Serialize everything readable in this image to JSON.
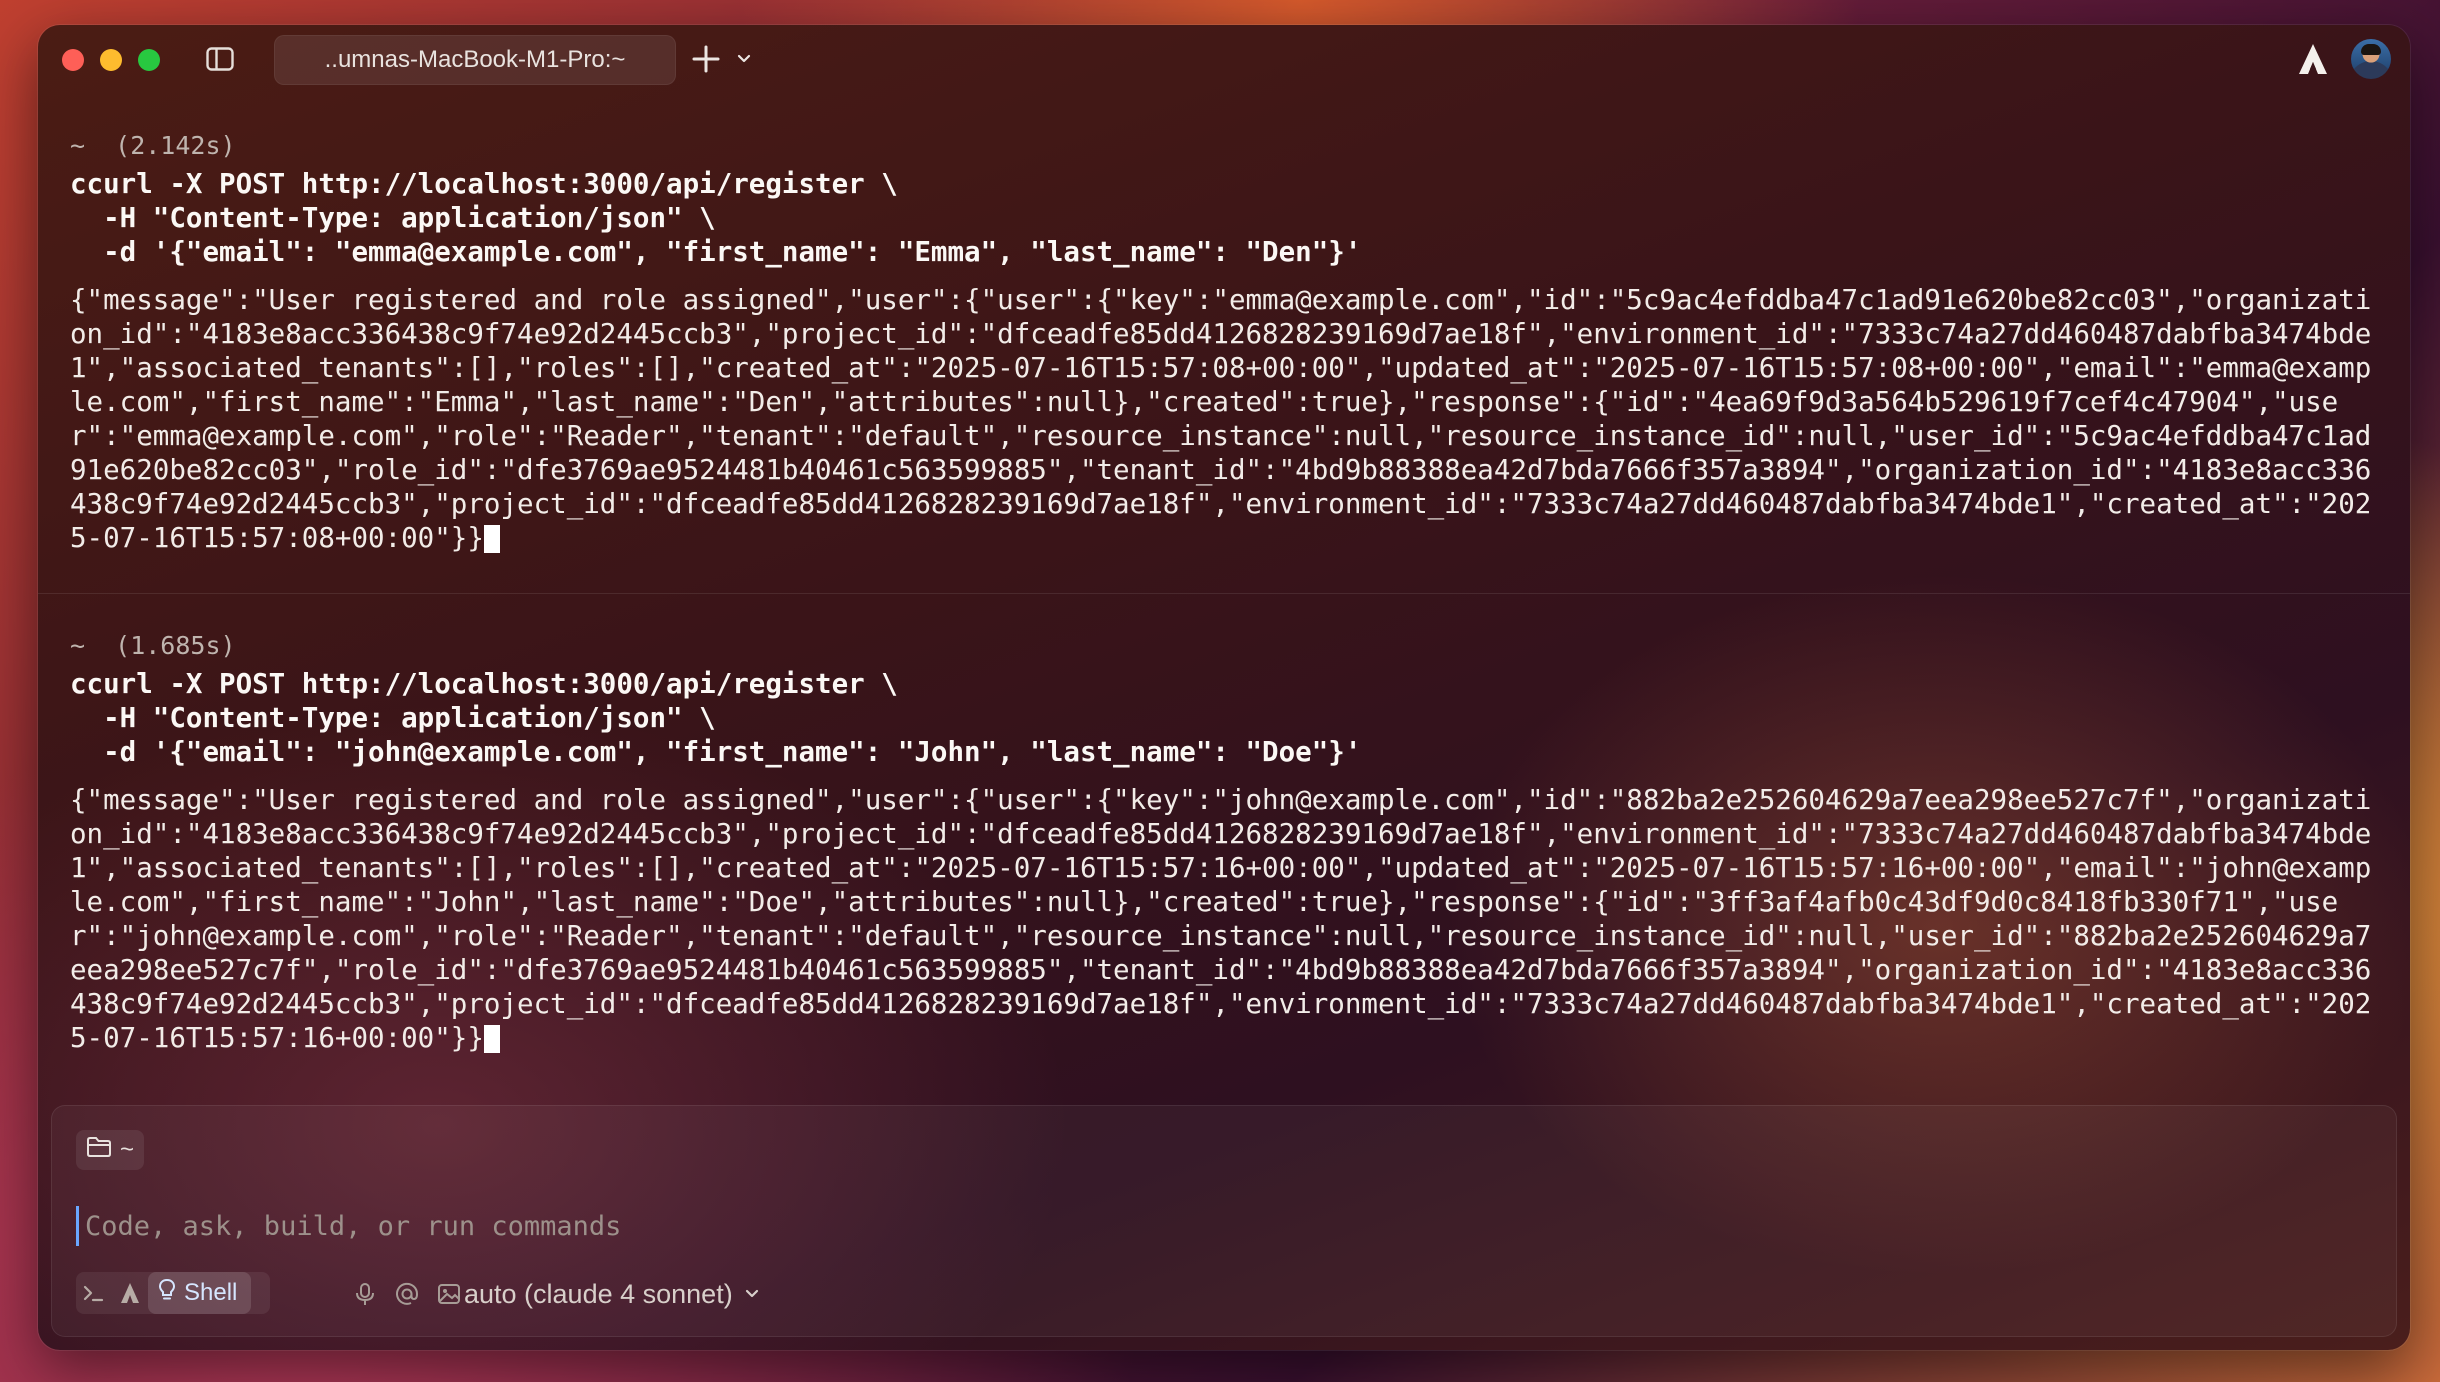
{
  "window": {
    "tab_title": "..umnas-MacBook-M1-Pro:~"
  },
  "blocks": [
    {
      "meta": "~  (2.142s)",
      "command_lines": [
        "ccurl -X POST http://localhost:3000/api/register \\",
        "  -H \"Content-Type: application/json\" \\",
        "  -d '{\"email\": \"emma@example.com\", \"first_name\": \"Emma\", \"last_name\": \"Den\"}'"
      ],
      "output": "{\"message\":\"User registered and role assigned\",\"user\":{\"user\":{\"key\":\"emma@example.com\",\"id\":\"5c9ac4efddba47c1ad91e620be82cc03\",\"organization_id\":\"4183e8acc336438c9f74e92d2445ccb3\",\"project_id\":\"dfceadfe85dd4126828239169d7ae18f\",\"environment_id\":\"7333c74a27dd460487dabfba3474bde1\",\"associated_tenants\":[],\"roles\":[],\"created_at\":\"2025-07-16T15:57:08+00:00\",\"updated_at\":\"2025-07-16T15:57:08+00:00\",\"email\":\"emma@example.com\",\"first_name\":\"Emma\",\"last_name\":\"Den\",\"attributes\":null},\"created\":true},\"response\":{\"id\":\"4ea69f9d3a564b529619f7cef4c47904\",\"user\":\"emma@example.com\",\"role\":\"Reader\",\"tenant\":\"default\",\"resource_instance\":null,\"resource_instance_id\":null,\"user_id\":\"5c9ac4efddba47c1ad91e620be82cc03\",\"role_id\":\"dfe3769ae9524481b40461c563599885\",\"tenant_id\":\"4bd9b88388ea42d7bda7666f357a3894\",\"organization_id\":\"4183e8acc336438c9f74e92d2445ccb3\",\"project_id\":\"dfceadfe85dd4126828239169d7ae18f\",\"environment_id\":\"7333c74a27dd460487dabfba3474bde1\",\"created_at\":\"2025-07-16T15:57:08+00:00\"}}"
    },
    {
      "meta": "~  (1.685s)",
      "command_lines": [
        "ccurl -X POST http://localhost:3000/api/register \\",
        "  -H \"Content-Type: application/json\" \\",
        "  -d '{\"email\": \"john@example.com\", \"first_name\": \"John\", \"last_name\": \"Doe\"}'"
      ],
      "output": "{\"message\":\"User registered and role assigned\",\"user\":{\"user\":{\"key\":\"john@example.com\",\"id\":\"882ba2e252604629a7eea298ee527c7f\",\"organization_id\":\"4183e8acc336438c9f74e92d2445ccb3\",\"project_id\":\"dfceadfe85dd4126828239169d7ae18f\",\"environment_id\":\"7333c74a27dd460487dabfba3474bde1\",\"associated_tenants\":[],\"roles\":[],\"created_at\":\"2025-07-16T15:57:16+00:00\",\"updated_at\":\"2025-07-16T15:57:16+00:00\",\"email\":\"john@example.com\",\"first_name\":\"John\",\"last_name\":\"Doe\",\"attributes\":null},\"created\":true},\"response\":{\"id\":\"3ff3af4afb0c43df9d0c8418fb330f71\",\"user\":\"john@example.com\",\"role\":\"Reader\",\"tenant\":\"default\",\"resource_instance\":null,\"resource_instance_id\":null,\"user_id\":\"882ba2e252604629a7eea298ee527c7f\",\"role_id\":\"dfe3769ae9524481b40461c563599885\",\"tenant_id\":\"4bd9b88388ea42d7bda7666f357a3894\",\"organization_id\":\"4183e8acc336438c9f74e92d2445ccb3\",\"project_id\":\"dfceadfe85dd4126828239169d7ae18f\",\"environment_id\":\"7333c74a27dd460487dabfba3474bde1\",\"created_at\":\"2025-07-16T15:57:16+00:00\"}}"
    }
  ],
  "composer": {
    "directory": "~",
    "placeholder": "Code, ask, build, or run commands",
    "mode_label": "Shell",
    "model_label": "auto (claude 4 sonnet)"
  },
  "icons": {
    "sidebar_toggle": "sidebar-toggle-icon",
    "new_tab": "plus-icon",
    "tab_menu": "chevron-down-icon",
    "brand": "warp-logo-icon",
    "folder": "folder-icon",
    "terminal_mode": "terminal-prompt-icon",
    "agent_mode": "agent-icon",
    "shell_mode": "lightbulb-icon",
    "mic": "microphone-icon",
    "mention": "at-sign-icon",
    "image": "image-icon",
    "model_menu": "chevron-down-icon"
  },
  "colors": {
    "close": "#fe5f57",
    "minimize": "#febc2e",
    "maximize": "#28c840",
    "caret": "#6aa7ff"
  }
}
